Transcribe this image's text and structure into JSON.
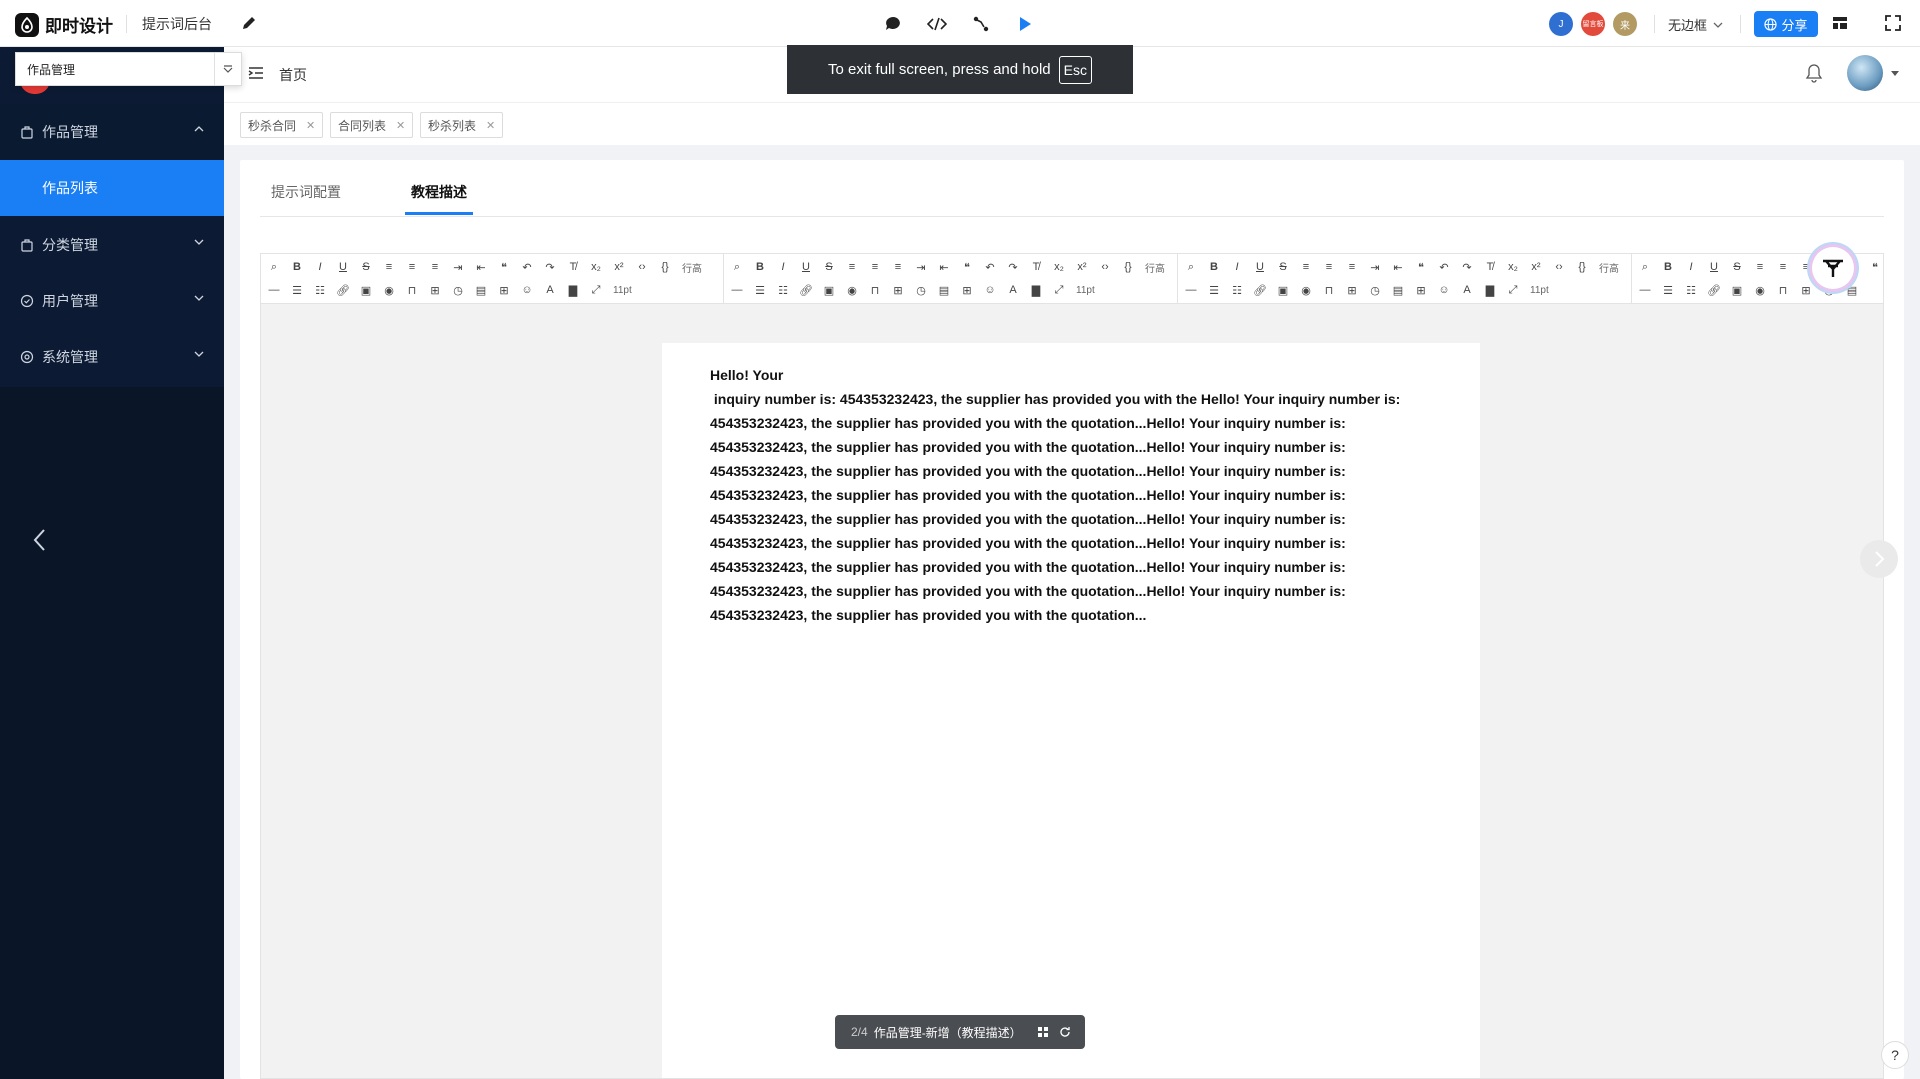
{
  "app": {
    "name": "即时设计",
    "title": "提示词后台"
  },
  "topbar": {
    "avatars": [
      {
        "label": "J",
        "color": "#2f6fd1"
      },
      {
        "label": "留言板",
        "color": "#e24a3b"
      },
      {
        "label": "来",
        "color": "#b29a62"
      }
    ],
    "zoom_label": "无边框",
    "share_label": "分享"
  },
  "toast": {
    "text": "To exit full screen, press and hold",
    "key": "Esc"
  },
  "dropdown": {
    "value": "作品管理"
  },
  "sidebar": {
    "items": [
      {
        "label": "作品管理"
      },
      {
        "label": "分类管理"
      },
      {
        "label": "用户管理"
      },
      {
        "label": "系统管理"
      }
    ],
    "active_sub": "作品列表"
  },
  "header": {
    "home": "首页"
  },
  "tags": [
    "秒杀合同",
    "合同列表",
    "秒杀列表"
  ],
  "tabs": [
    {
      "label": "提示词配置"
    },
    {
      "label": "教程描述"
    }
  ],
  "toolbar": {
    "line_height": "行高",
    "font_size": "11pt"
  },
  "document": {
    "text": "Hello! Your\n inquiry number is: 454353232423, the supplier has provided you with the Hello! Your inquiry number is:\n454353232423, the supplier has provided you with the quotation...Hello! Your inquiry number is:\n454353232423, the supplier has provided you with the quotation...Hello! Your inquiry number is:\n454353232423, the supplier has provided you with the quotation...Hello! Your inquiry number is:\n454353232423, the supplier has provided you with the quotation...Hello! Your inquiry number is:\n454353232423, the supplier has provided you with the quotation...Hello! Your inquiry number is:\n454353232423, the supplier has provided you with the quotation...Hello! Your inquiry number is:\n454353232423, the supplier has provided you with the quotation...Hello! Your inquiry number is:\n454353232423, the supplier has provided you with the quotation...Hello! Your inquiry number is:\n454353232423, the supplier has provided you with the quotation..."
  },
  "pager": {
    "position": "2/4",
    "label": "作品管理-新增（教程描述）"
  },
  "help": "?"
}
